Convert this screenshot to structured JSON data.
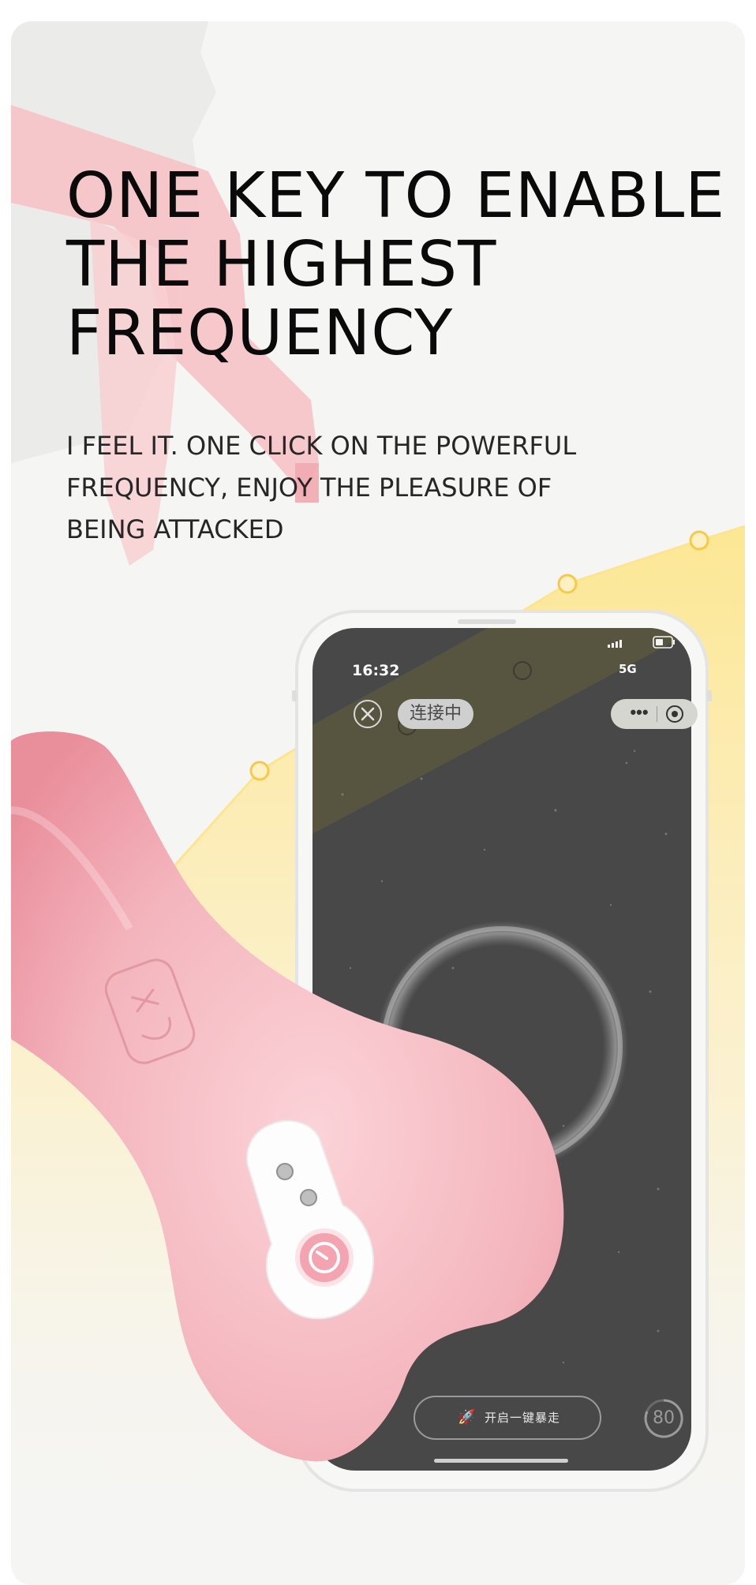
{
  "headline": {
    "line1": "ONE KEY TO ENABLE",
    "line2": "THE HIGHEST",
    "line3": "FREQUENCY"
  },
  "subtext": {
    "line1": "I FEEL IT. ONE CLICK ON THE POWERFUL",
    "line2": "FREQUENCY, ENJOY THE PLEASURE OF",
    "line3": "BEING ATTACKED"
  },
  "phone": {
    "status_time": "16:32",
    "status_network": "5G",
    "connection_status": "连接中",
    "more_glyph": "•••",
    "boost_button_label": "开启一键暴走",
    "intensity_level": "80"
  },
  "colors": {
    "card_background": "#f5f5f4",
    "headline_text": "#0a0a0a",
    "phone_screen": "#4a4a4a",
    "device_pink": "#f1aab4",
    "chart_yellow": "#fde58f",
    "chart_point": "#f7c94a"
  },
  "icons": [
    "close-icon",
    "more-dots-icon",
    "target-icon",
    "rocket-icon",
    "battery-icon",
    "signal-bars-icon",
    "power-logo-icon"
  ]
}
